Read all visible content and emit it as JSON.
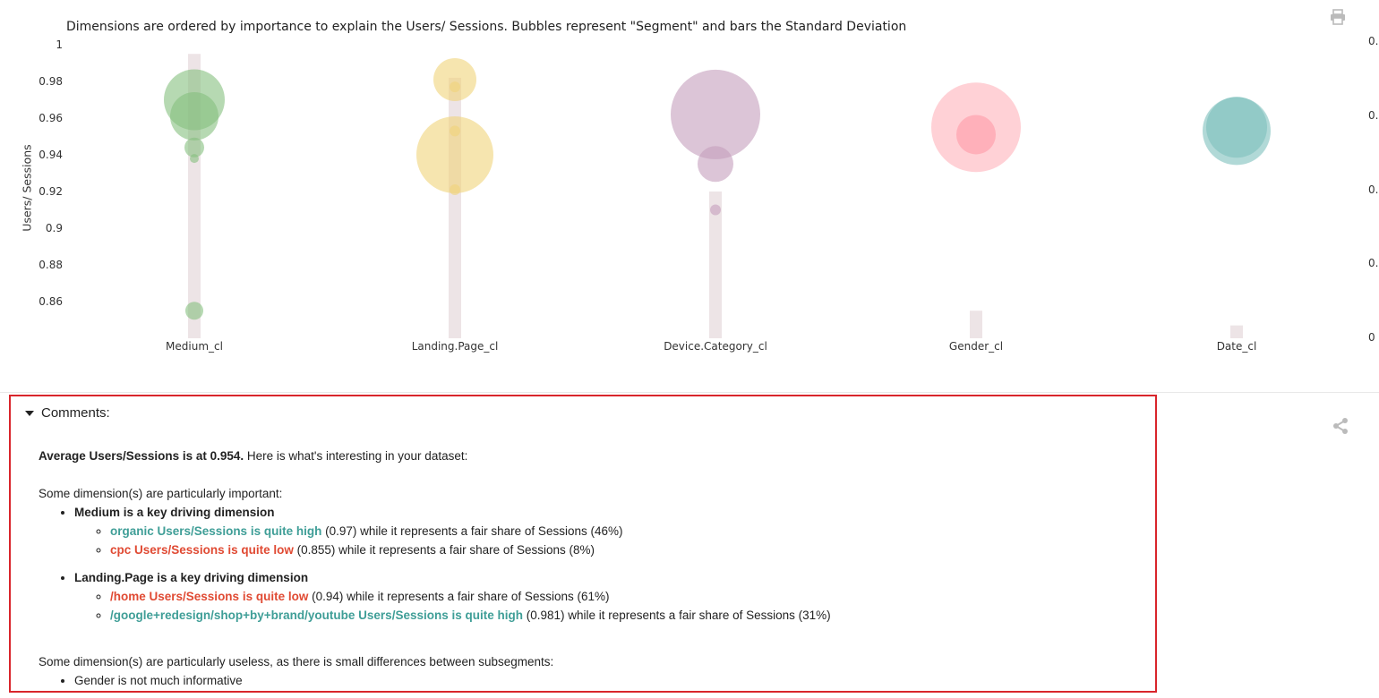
{
  "chart_data": {
    "type": "scatter",
    "title": "Dimensions are ordered by importance to explain the Users/ Sessions. Bubbles represent \"Segment\" and bars the Standard Deviation",
    "ylabel": "Users/ Sessions",
    "ylim": [
      0.84,
      1.0
    ],
    "yticks": [
      "1",
      "0.98",
      "0.96",
      "0.94",
      "0.92",
      "0.9",
      "0.88",
      "0.86"
    ],
    "right_axis_ticks": [
      "0.",
      "0.",
      "0.",
      "0.",
      "0"
    ],
    "categories": [
      "Medium_cl",
      "Landing.Page_cl",
      "Device.Category_cl",
      "Gender_cl",
      "Date_cl"
    ],
    "std_bars": [
      {
        "category": "Medium_cl",
        "top": 0.995
      },
      {
        "category": "Landing.Page_cl",
        "top": 0.982
      },
      {
        "category": "Device.Category_cl",
        "top": 0.92
      },
      {
        "category": "Gender_cl",
        "top": 0.855
      },
      {
        "category": "Date_cl",
        "top": 0.847
      }
    ],
    "bubbles": [
      {
        "category": "Medium_cl",
        "y": 0.97,
        "size": 34,
        "color": "#86c07e"
      },
      {
        "category": "Medium_cl",
        "y": 0.961,
        "size": 27,
        "color": "#86c07e"
      },
      {
        "category": "Medium_cl",
        "y": 0.944,
        "size": 11,
        "color": "#86c07e"
      },
      {
        "category": "Medium_cl",
        "y": 0.938,
        "size": 5,
        "color": "#86c07e"
      },
      {
        "category": "Medium_cl",
        "y": 0.855,
        "size": 10,
        "color": "#86c07e"
      },
      {
        "category": "Landing.Page_cl",
        "y": 0.981,
        "size": 24,
        "color": "#f0d47a"
      },
      {
        "category": "Landing.Page_cl",
        "y": 0.977,
        "size": 6,
        "color": "#f0d47a"
      },
      {
        "category": "Landing.Page_cl",
        "y": 0.94,
        "size": 43,
        "color": "#f0d47a"
      },
      {
        "category": "Landing.Page_cl",
        "y": 0.953,
        "size": 6,
        "color": "#f0d47a"
      },
      {
        "category": "Landing.Page_cl",
        "y": 0.921,
        "size": 6,
        "color": "#f0d47a"
      },
      {
        "category": "Device.Category_cl",
        "y": 0.962,
        "size": 50,
        "color": "#c49fbc"
      },
      {
        "category": "Device.Category_cl",
        "y": 0.935,
        "size": 20,
        "color": "#c49fbc"
      },
      {
        "category": "Device.Category_cl",
        "y": 0.91,
        "size": 6,
        "color": "#c49fbc"
      },
      {
        "category": "Gender_cl",
        "y": 0.955,
        "size": 50,
        "color": "#ffb3bb"
      },
      {
        "category": "Gender_cl",
        "y": 0.951,
        "size": 22,
        "color": "#ff9aa6"
      },
      {
        "category": "Date_cl",
        "y": 0.953,
        "size": 38,
        "color": "#7dbfbc"
      },
      {
        "category": "Date_cl",
        "y": 0.955,
        "size": 34,
        "color": "#7dbfbc"
      }
    ]
  },
  "colors": {
    "std_bar": "#ede4e6",
    "high": "#3f9e97",
    "low": "#e04a33",
    "highlight_border": "#d9252b"
  },
  "icons": {
    "print": "print-icon",
    "share": "share-icon"
  },
  "comments": {
    "header": "Comments:",
    "avg_bold": "Average Users/Sessions is at 0.954.",
    "avg_rest": " Here is what's interesting in your dataset:",
    "important_intro": "Some dimension(s) are particularly important:",
    "dims": [
      {
        "title": "Medium is a key driving dimension",
        "items": [
          {
            "highlight": "organic Users/Sessions is quite high",
            "rest": " (0.97) while it represents a fair share of Sessions (46%)"
          },
          {
            "highlight": "cpc Users/Sessions is quite low",
            "rest": " (0.855) while it represents a fair share of Sessions (8%)"
          }
        ]
      },
      {
        "title": "Landing.Page is a key driving dimension",
        "items": [
          {
            "highlight": "/home Users/Sessions is quite low",
            "rest": " (0.94) while it represents a fair share of Sessions (61%)"
          },
          {
            "highlight": "/google+redesign/shop+by+brand/youtube Users/Sessions is quite high",
            "rest": " (0.981) while it represents a fair share of Sessions (31%)"
          }
        ]
      }
    ],
    "useless_intro": "Some dimension(s) are particularly useless, as there is small differences between subsegments:",
    "useless_items": [
      "Gender is not much informative"
    ]
  }
}
